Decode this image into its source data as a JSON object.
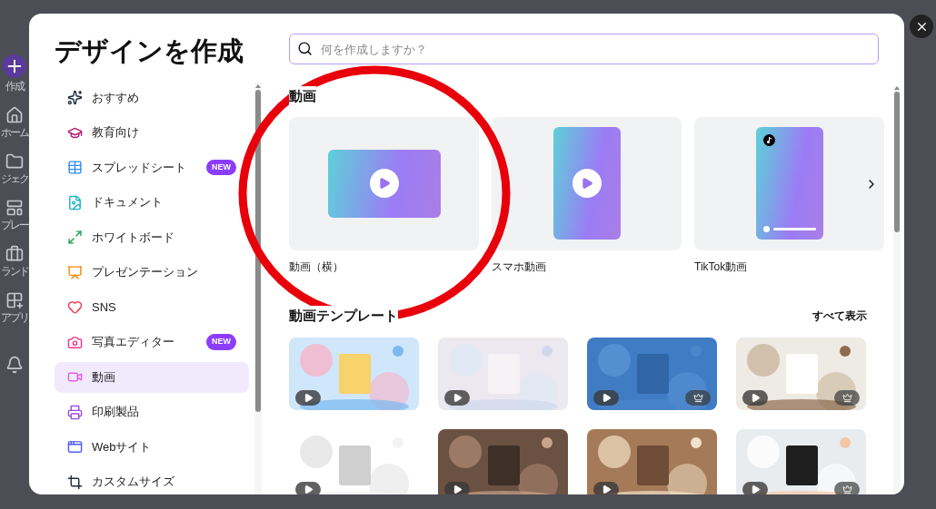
{
  "background_sidebar": {
    "items": [
      "作成",
      "ホーム",
      "ジェク",
      "プレー",
      "ランド",
      "アプリ"
    ]
  },
  "dialog": {
    "title": "デザインを作成",
    "search": {
      "placeholder": "何を作成しますか？"
    },
    "nav": [
      {
        "label": "おすすめ",
        "selected": false
      },
      {
        "label": "教育向け",
        "selected": false
      },
      {
        "label": "スプレッドシート",
        "selected": false,
        "badge": "NEW"
      },
      {
        "label": "ドキュメント",
        "selected": false
      },
      {
        "label": "ホワイトボード",
        "selected": false
      },
      {
        "label": "プレゼンテーション",
        "selected": false
      },
      {
        "label": "SNS",
        "selected": false
      },
      {
        "label": "写真エディター",
        "selected": false,
        "badge": "NEW"
      },
      {
        "label": "動画",
        "selected": true
      },
      {
        "label": "印刷製品",
        "selected": false
      },
      {
        "label": "Webサイト",
        "selected": false
      },
      {
        "label": "カスタムサイズ",
        "selected": false
      }
    ],
    "section_title": "動画",
    "formats": [
      {
        "label": "動画（横）",
        "kind": "landscape"
      },
      {
        "label": "スマホ動画",
        "kind": "portrait"
      },
      {
        "label": "TikTok動画",
        "kind": "tiktok"
      }
    ],
    "templates_title": "動画テンプレート",
    "see_all": "すべて表示",
    "templates": [
      {
        "kind": "picture",
        "premium": false
      },
      {
        "kind": "picture",
        "premium": false
      },
      {
        "kind": "picture",
        "premium": true
      },
      {
        "kind": "picture",
        "premium": true
      },
      {
        "kind": "picture",
        "premium": false
      },
      {
        "kind": "picture",
        "premium": false
      },
      {
        "kind": "picture",
        "premium": false
      },
      {
        "kind": "picture",
        "premium": true
      }
    ]
  },
  "annotation": {
    "kind": "circle"
  }
}
